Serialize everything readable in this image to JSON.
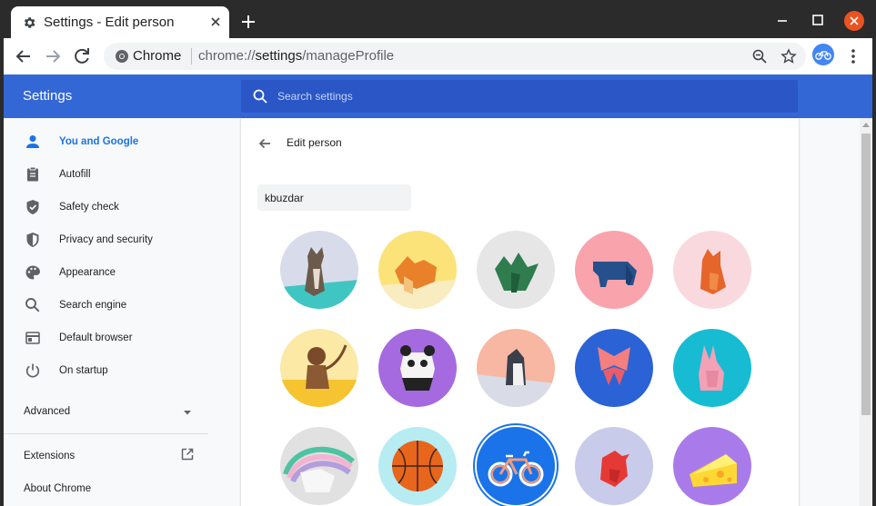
{
  "window": {
    "tab_title": "Settings - Edit person",
    "colors": {
      "frame": "#2b2b2b",
      "close": "#e95420"
    }
  },
  "toolbar": {
    "site_label": "Chrome",
    "url_prefix": "chrome://",
    "url_host": "settings",
    "url_path": "/manageProfile"
  },
  "header": {
    "title": "Settings",
    "search_placeholder": "Search settings",
    "colors": {
      "header": "#3367d6",
      "search": "#2a56c6"
    }
  },
  "sidebar": {
    "items": [
      {
        "label": "You and Google",
        "icon": "person-icon",
        "active": true
      },
      {
        "label": "Autofill",
        "icon": "clipboard-icon",
        "active": false
      },
      {
        "label": "Safety check",
        "icon": "shield-check-icon",
        "active": false
      },
      {
        "label": "Privacy and security",
        "icon": "shield-icon",
        "active": false
      },
      {
        "label": "Appearance",
        "icon": "palette-icon",
        "active": false
      },
      {
        "label": "Search engine",
        "icon": "search-icon",
        "active": false
      },
      {
        "label": "Default browser",
        "icon": "browser-icon",
        "active": false
      },
      {
        "label": "On startup",
        "icon": "power-icon",
        "active": false
      }
    ],
    "advanced_label": "Advanced",
    "extensions_label": "Extensions",
    "about_label": "About Chrome",
    "accent": "#1a73e8"
  },
  "edit_person": {
    "title": "Edit person",
    "name_value": "kbuzdar",
    "avatars": [
      {
        "name": "cat-avatar",
        "bg": "#d8dcea"
      },
      {
        "name": "fox-avatar",
        "bg": "#fbe37a"
      },
      {
        "name": "dragon-avatar",
        "bg": "#e6e6e6"
      },
      {
        "name": "elephant-avatar",
        "bg": "#f9a3ac"
      },
      {
        "name": "fox-pink-avatar",
        "bg": "#f9d9de"
      },
      {
        "name": "monkey-avatar",
        "bg": "#fbe9a5"
      },
      {
        "name": "panda-avatar",
        "bg": "#a66ae0"
      },
      {
        "name": "penguin-avatar",
        "bg": "#f7b7a2"
      },
      {
        "name": "butterfly-avatar",
        "bg": "#2b63d6"
      },
      {
        "name": "rabbit-avatar",
        "bg": "#17bcd3"
      },
      {
        "name": "unicorn-avatar",
        "bg": "#e1e1e1"
      },
      {
        "name": "basketball-avatar",
        "bg": "#b6ecf2"
      },
      {
        "name": "bicycle-avatar",
        "bg": "#1a73e8"
      },
      {
        "name": "bird-avatar",
        "bg": "#c9cbeb"
      },
      {
        "name": "cheese-avatar",
        "bg": "#a97bea"
      }
    ],
    "selected_avatar": "bicycle-avatar"
  }
}
